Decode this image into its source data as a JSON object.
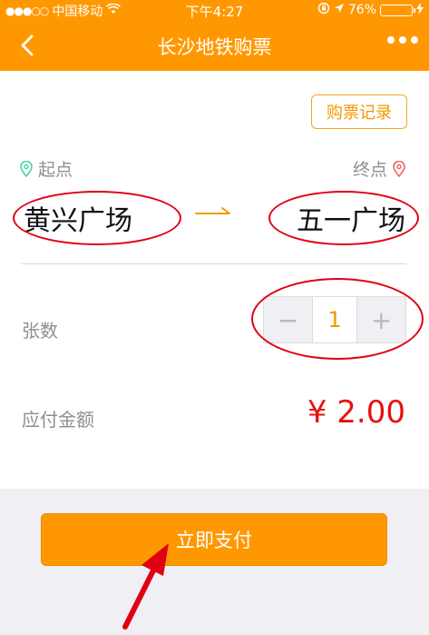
{
  "status_bar": {
    "carrier": "中国移动",
    "time": "下午4:27",
    "battery": "76%",
    "battery_level": 0.76
  },
  "nav": {
    "title": "长沙地铁购票"
  },
  "ticket": {
    "record_button": "购票记录",
    "start_label": "起点",
    "end_label": "终点",
    "start_station": "黄兴广场",
    "end_station": "五一广场",
    "quantity_label": "张数",
    "quantity_value": "1",
    "minus_symbol": "−",
    "plus_symbol": "+",
    "amount_label": "应付金额",
    "amount_value": "¥ 2.00"
  },
  "pay_button": "立即支付",
  "colors": {
    "accent": "#ff9800",
    "price": "#e8110f",
    "annotation": "#e00012",
    "location_start": "#4cd1a0",
    "location_end": "#f06060"
  },
  "icons": [
    "signal-dots-icon",
    "wifi-icon",
    "lock-rotation-icon",
    "location-arrow-icon",
    "battery-icon",
    "charging-icon",
    "back-icon",
    "more-icon",
    "location-pin-icon",
    "arrow-right-icon"
  ]
}
